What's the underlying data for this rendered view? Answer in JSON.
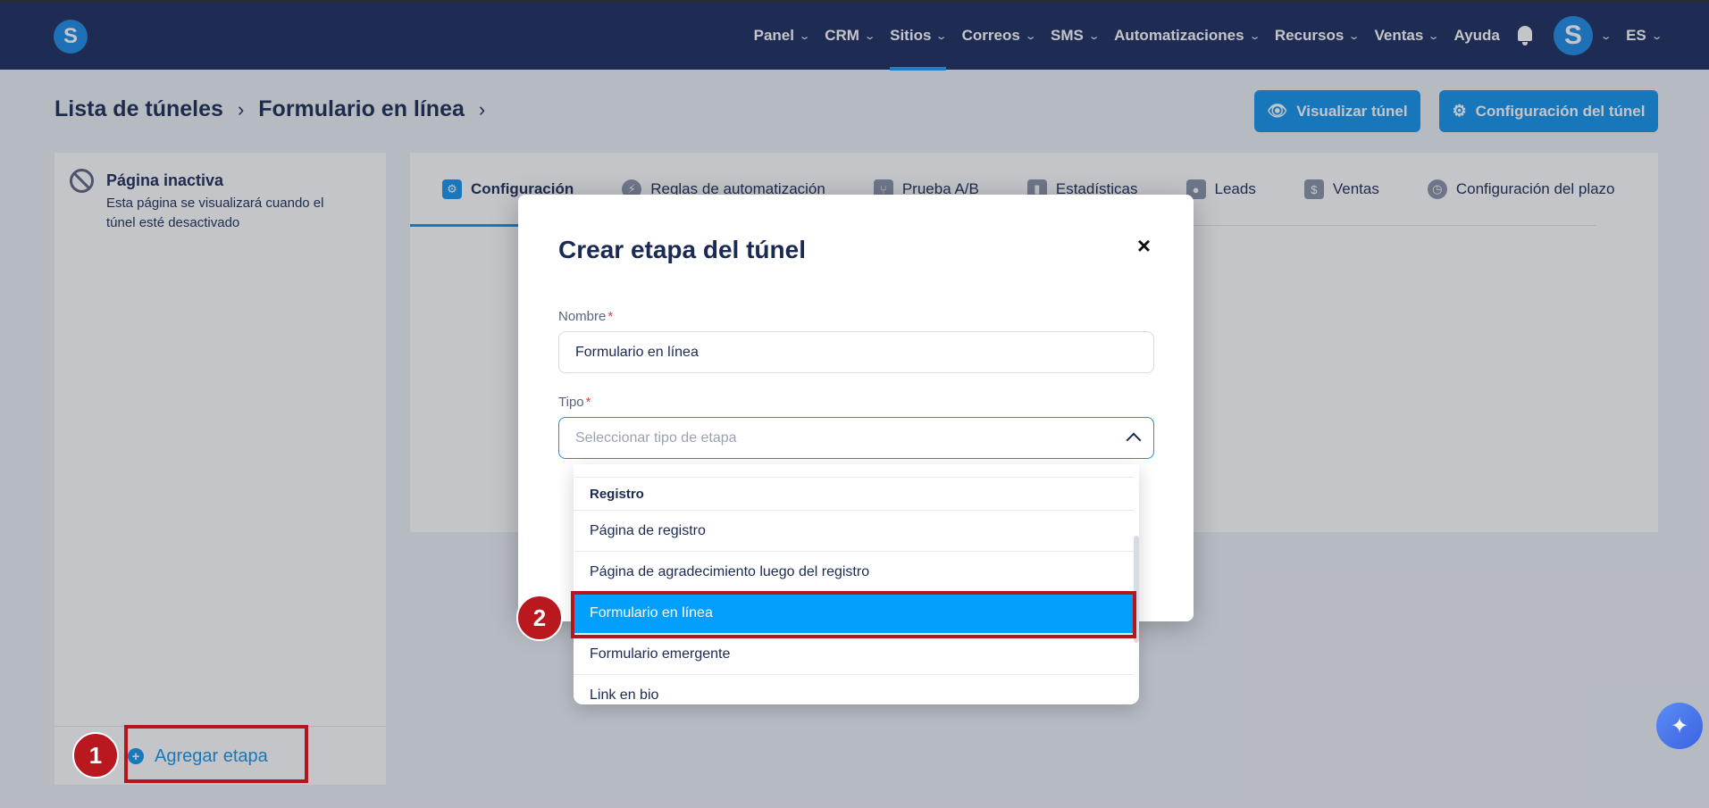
{
  "nav": {
    "logo": "S",
    "items": [
      {
        "label": "Panel",
        "chevron": true
      },
      {
        "label": "CRM",
        "chevron": true
      },
      {
        "label": "Sitios",
        "chevron": true,
        "active": true
      },
      {
        "label": "Correos",
        "chevron": true
      },
      {
        "label": "SMS",
        "chevron": true
      },
      {
        "label": "Automatizaciones",
        "chevron": true
      },
      {
        "label": "Recursos",
        "chevron": true
      },
      {
        "label": "Ventas",
        "chevron": true
      },
      {
        "label": "Ayuda",
        "chevron": false
      }
    ],
    "avatar_letter": "S",
    "language": "ES"
  },
  "breadcrumb": {
    "items": [
      "Lista de túneles",
      "Formulario en línea"
    ]
  },
  "actions": {
    "preview_label": "Visualizar túnel",
    "settings_label": "Configuración del túnel"
  },
  "sidebar": {
    "inactive_title": "Página inactiva",
    "inactive_desc": "Esta página se visualizará cuando el túnel esté desactivado",
    "add_stage_label": "Agregar etapa"
  },
  "tabs": [
    {
      "label": "Configuración",
      "icon": "sliders-icon",
      "glyph": "⚙",
      "active": true
    },
    {
      "label": "Reglas de automatización",
      "icon": "bolt-icon",
      "glyph": "⚡"
    },
    {
      "label": "Prueba A/B",
      "icon": "split-icon",
      "glyph": "⑂"
    },
    {
      "label": "Estadísticas",
      "icon": "bar-chart-icon",
      "glyph": "▮"
    },
    {
      "label": "Leads",
      "icon": "users-icon",
      "glyph": "●"
    },
    {
      "label": "Ventas",
      "icon": "dollar-icon",
      "glyph": "$"
    },
    {
      "label": "Configuración del plazo",
      "icon": "clock-icon",
      "glyph": "◷"
    }
  ],
  "modal": {
    "title": "Crear etapa del túnel",
    "close": "×",
    "name_label": "Nombre",
    "name_value": "Formulario en línea",
    "type_label": "Tipo",
    "type_placeholder": "Seleccionar tipo de etapa",
    "required_mark": "*"
  },
  "dropdown": {
    "options": [
      {
        "label": "Registro",
        "group": true
      },
      {
        "label": "Página de registro"
      },
      {
        "label": "Página de agradecimiento luego del registro"
      },
      {
        "label": "Formulario en línea",
        "selected": true
      },
      {
        "label": "Formulario emergente"
      },
      {
        "label": "Link en bio"
      }
    ]
  },
  "annotations": {
    "step1": "1",
    "step2": "2",
    "highlight_color": "#b5161c"
  },
  "colors": {
    "nav_bg": "#1b2a5c",
    "accent": "#1493ea",
    "selected_option": "#02a0fc"
  }
}
